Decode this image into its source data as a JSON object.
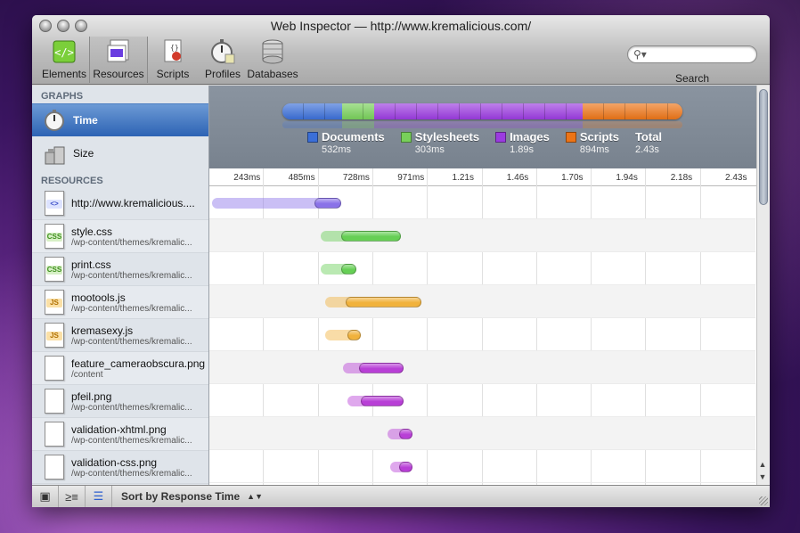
{
  "window": {
    "title": "Web Inspector — http://www.kremalicious.com/"
  },
  "toolbar": {
    "items": [
      {
        "label": "Elements",
        "icon": "elements-icon"
      },
      {
        "label": "Resources",
        "icon": "resources-icon"
      },
      {
        "label": "Scripts",
        "icon": "scripts-icon"
      },
      {
        "label": "Profiles",
        "icon": "profiles-icon"
      },
      {
        "label": "Databases",
        "icon": "databases-icon"
      }
    ],
    "selected": "Resources",
    "search_label": "Search",
    "search_value": ""
  },
  "sidebar": {
    "graphs_header": "GRAPHS",
    "graphs": [
      {
        "label": "Time",
        "icon": "stopwatch-icon",
        "selected": true
      },
      {
        "label": "Size",
        "icon": "weight-icon",
        "selected": false
      }
    ],
    "resources_header": "RESOURCES",
    "resources": [
      {
        "name": "http://www.kremalicious....",
        "path": "",
        "type": "html"
      },
      {
        "name": "style.css",
        "path": "/wp-content/themes/kremalic...",
        "type": "css"
      },
      {
        "name": "print.css",
        "path": "/wp-content/themes/kremalic...",
        "type": "css"
      },
      {
        "name": "mootools.js",
        "path": "/wp-content/themes/kremalic...",
        "type": "js"
      },
      {
        "name": "kremasexy.js",
        "path": "/wp-content/themes/kremalic...",
        "type": "js"
      },
      {
        "name": "feature_cameraobscura.png",
        "path": "/content",
        "type": "image"
      },
      {
        "name": "pfeil.png",
        "path": "/wp-content/themes/kremalic...",
        "type": "image"
      },
      {
        "name": "validation-xhtml.png",
        "path": "/wp-content/themes/kremalic...",
        "type": "image"
      },
      {
        "name": "validation-css.png",
        "path": "/wp-content/themes/kremalic...",
        "type": "image"
      }
    ]
  },
  "summary": {
    "categories": [
      {
        "name": "Documents",
        "value": "532ms",
        "color": "#3b6fd8"
      },
      {
        "name": "Stylesheets",
        "value": "303ms",
        "color": "#78d05a"
      },
      {
        "name": "Images",
        "value": "1.89s",
        "color": "#9b3be0"
      },
      {
        "name": "Scripts",
        "value": "894ms",
        "color": "#ec7417"
      }
    ],
    "total_label": "Total",
    "total_value": "2.43s",
    "bar_fractions": [
      0.15,
      0.08,
      0.52,
      0.25
    ]
  },
  "timeline": {
    "ticks": [
      "243ms",
      "485ms",
      "728ms",
      "971ms",
      "1.21s",
      "1.46s",
      "1.70s",
      "1.94s",
      "2.18s",
      "2.43s"
    ],
    "max_ms": 2430,
    "rows": [
      {
        "start": 0,
        "response": 460,
        "end": 580,
        "color": "#8a72e8"
      },
      {
        "start": 490,
        "response": 580,
        "end": 850,
        "color": "#66cf55"
      },
      {
        "start": 490,
        "response": 580,
        "end": 650,
        "color": "#66cf55"
      },
      {
        "start": 510,
        "response": 600,
        "end": 940,
        "color": "#f1b23c"
      },
      {
        "start": 510,
        "response": 610,
        "end": 670,
        "color": "#f1b23c"
      },
      {
        "start": 590,
        "response": 660,
        "end": 860,
        "color": "#b83fd6"
      },
      {
        "start": 610,
        "response": 670,
        "end": 860,
        "color": "#b83fd6"
      },
      {
        "start": 790,
        "response": 840,
        "end": 900,
        "color": "#b83fd6"
      },
      {
        "start": 800,
        "response": 840,
        "end": 900,
        "color": "#b83fd6"
      }
    ]
  },
  "statusbar": {
    "sort_label": "Sort by Response Time"
  }
}
